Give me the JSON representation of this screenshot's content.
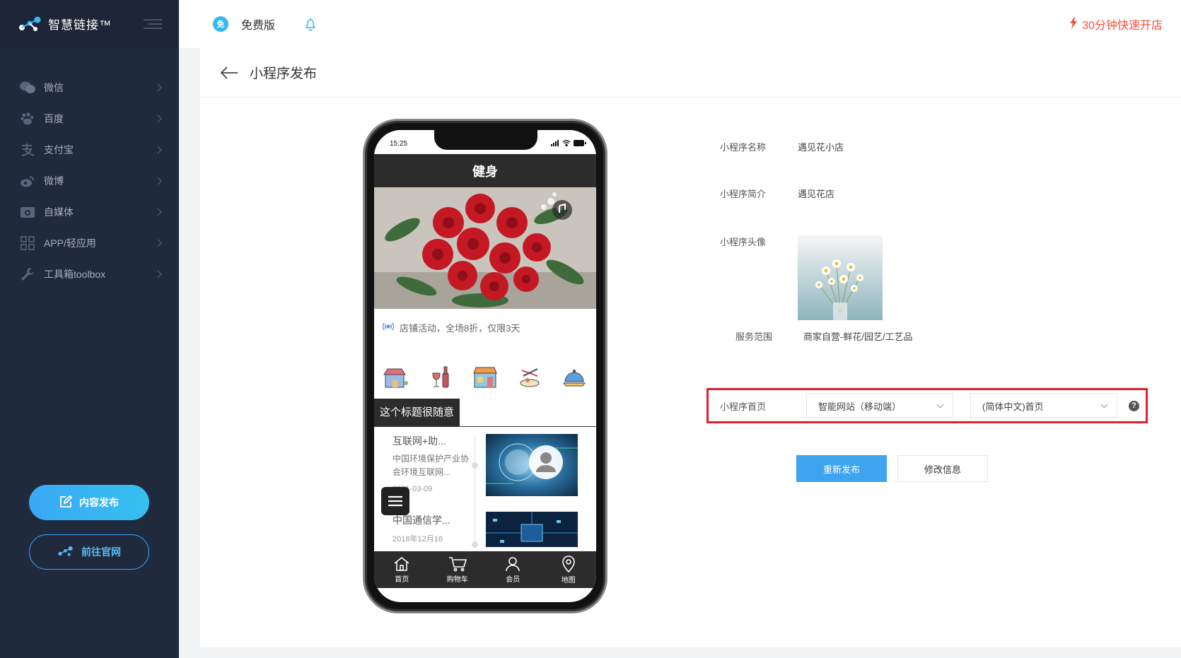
{
  "app": {
    "logo_text": "智慧链接™",
    "accent_color": "#36b7f0",
    "sidebar_bg": "#1f2a3d"
  },
  "sidebar": {
    "items": [
      {
        "label": "微信",
        "icon": "wechat-icon"
      },
      {
        "label": "百度",
        "icon": "baidu-paw-icon"
      },
      {
        "label": "支付宝",
        "icon": "alipay-icon"
      },
      {
        "label": "微博",
        "icon": "weibo-icon"
      },
      {
        "label": "自媒体",
        "icon": "media-icon"
      },
      {
        "label": "APP/轻应用",
        "icon": "app-grid-icon"
      },
      {
        "label": "工具箱toolbox",
        "icon": "wrench-icon"
      }
    ],
    "publish_button": "内容发布",
    "site_button": "前往官网"
  },
  "topbar": {
    "plan": "免费版",
    "quick_open": "30分钟快速开店",
    "quick_open_color": "#f0523a"
  },
  "page": {
    "title": "小程序发布"
  },
  "phone": {
    "status_time": "15:25",
    "app_title": "健身",
    "notice": "店铺活动，全场8折，仅限3天",
    "section_title": "这个标题很随意",
    "news": [
      {
        "title": "互联网+助...",
        "desc": "中国环境保护产业协会环境互联网...",
        "date": "2021-03-09"
      },
      {
        "title": "中国通信学...",
        "date": "2018年12月16"
      }
    ],
    "tabs": [
      "首页",
      "购物车",
      "会员",
      "地图"
    ]
  },
  "form": {
    "name_label": "小程序名称",
    "name_value": "遇见花小店",
    "intro_label": "小程序简介",
    "intro_value": "遇见花店",
    "avatar_label": "小程序头像",
    "scope_label": "服务范围",
    "scope_value": "商家自营-鲜花/园艺/工艺品",
    "home_label": "小程序首页",
    "home_select_1": "智能网站（移动端）",
    "home_select_2": "(简体中文)首页",
    "help": "?",
    "republish_button": "重新发布",
    "edit_button": "修改信息"
  }
}
